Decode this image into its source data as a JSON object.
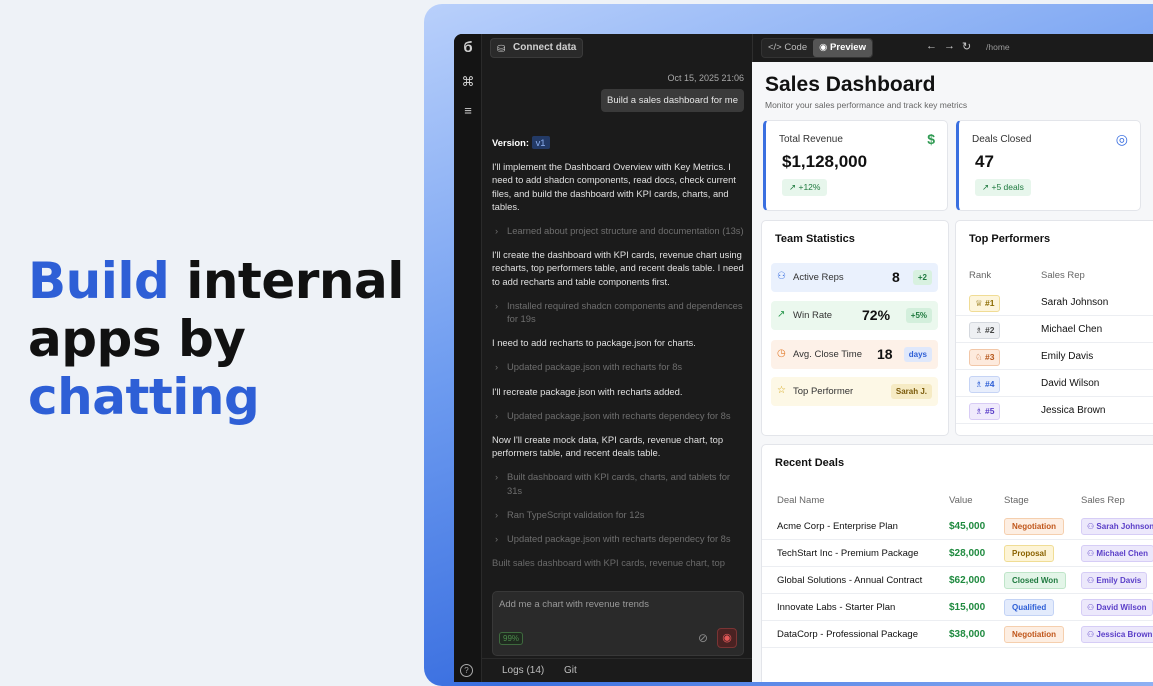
{
  "hero": {
    "line1a": "Build",
    "line1b": " internal",
    "line2": "apps by",
    "line3": "chatting"
  },
  "toolbar": {
    "connect_label": "Connect data",
    "code_label": "Code",
    "preview_label": "Preview",
    "url": "/home"
  },
  "chat": {
    "timestamp": "Oct 15, 2025 21:06",
    "user_message": "Build a sales dashboard for me",
    "version_label": "Version:",
    "version_tag": "v1",
    "messages": [
      {
        "kind": "p",
        "text": "I'll implement the Dashboard Overview with Key Metrics. I need to add shadcn components, read docs, check current files, and build the dashboard with KPI cards, charts, and tables."
      },
      {
        "kind": "step",
        "text": "Learned about project structure and documentation (13s)"
      },
      {
        "kind": "p",
        "text": "I'll create the dashboard with KPI cards, revenue chart using recharts, top performers table, and recent deals table. I need to add recharts and table components first."
      },
      {
        "kind": "step",
        "text": "Installed required shadcn components and dependences for 19s"
      },
      {
        "kind": "p",
        "text": "I need to add recharts to package.json for charts."
      },
      {
        "kind": "step",
        "text": "Updated package.json with recharts for 8s"
      },
      {
        "kind": "p",
        "text": "I'll recreate package.json with recharts added."
      },
      {
        "kind": "step",
        "text": "Updated package.json with recharts dependecy for 8s"
      },
      {
        "kind": "p",
        "text": "Now I'll create mock data, KPI cards, revenue chart, top performers table, and recent deals table."
      },
      {
        "kind": "step",
        "text": "Built dashboard with KPI cards, charts, and tablets for 31s"
      },
      {
        "kind": "step",
        "text": "Ran TypeScript validation for 12s"
      },
      {
        "kind": "step",
        "text": "Updated package.json with recharts dependecy for 8s"
      },
      {
        "kind": "faded",
        "text": "Built sales dashboard with KPI cards, revenue chart, top"
      }
    ],
    "input_placeholder": "Add me a chart with revenue trends",
    "context_pct": "99%",
    "logs_label": "Logs (14)",
    "git_label": "Git"
  },
  "dashboard": {
    "title": "Sales Dashboard",
    "subtitle": "Monitor your sales performance and track key metrics",
    "kpis": [
      {
        "label": "Total Revenue",
        "value": "$1,128,000",
        "change": "↗ +12%",
        "icon": "dollar-icon"
      },
      {
        "label": "Deals Closed",
        "value": "47",
        "change": "↗ +5 deals",
        "icon": "target-icon"
      }
    ],
    "team": {
      "title": "Team Statistics",
      "stats": [
        {
          "label": "Active Reps",
          "value": "8",
          "badge": "+2"
        },
        {
          "label": "Win Rate",
          "value": "72%",
          "badge": "+5%"
        },
        {
          "label": "Avg. Close Time",
          "value": "18",
          "badge": "days"
        },
        {
          "label": "Top Performer",
          "value": "",
          "badge": "Sarah J."
        }
      ]
    },
    "performers": {
      "title": "Top Performers",
      "headers": [
        "Rank",
        "Sales Rep"
      ],
      "rows": [
        {
          "rank": "♕ #1",
          "name": "Sarah Johnson"
        },
        {
          "rank": "♗ #2",
          "name": "Michael Chen"
        },
        {
          "rank": "♘ #3",
          "name": "Emily Davis"
        },
        {
          "rank": "♗ #4",
          "name": "David Wilson"
        },
        {
          "rank": "♗ #5",
          "name": "Jessica Brown"
        }
      ]
    },
    "deals": {
      "title": "Recent Deals",
      "headers": [
        "Deal Name",
        "Value",
        "Stage",
        "Sales Rep"
      ],
      "rows": [
        {
          "name": "Acme Corp - Enterprise Plan",
          "value": "$45,000",
          "stage": "Negotiation",
          "rep": "Sarah Johnson"
        },
        {
          "name": "TechStart Inc - Premium Package",
          "value": "$28,000",
          "stage": "Proposal",
          "rep": "Michael Chen"
        },
        {
          "name": "Global Solutions - Annual Contract",
          "value": "$62,000",
          "stage": "Closed Won",
          "rep": "Emily Davis"
        },
        {
          "name": "Innovate Labs - Starter Plan",
          "value": "$15,000",
          "stage": "Qualified",
          "rep": "David Wilson"
        },
        {
          "name": "DataCorp - Professional Package",
          "value": "$38,000",
          "stage": "Negotiation",
          "rep": "Jessica Brown"
        }
      ]
    }
  },
  "colors": {
    "accent": "#2e5fd6",
    "success": "#1f8a3f"
  }
}
